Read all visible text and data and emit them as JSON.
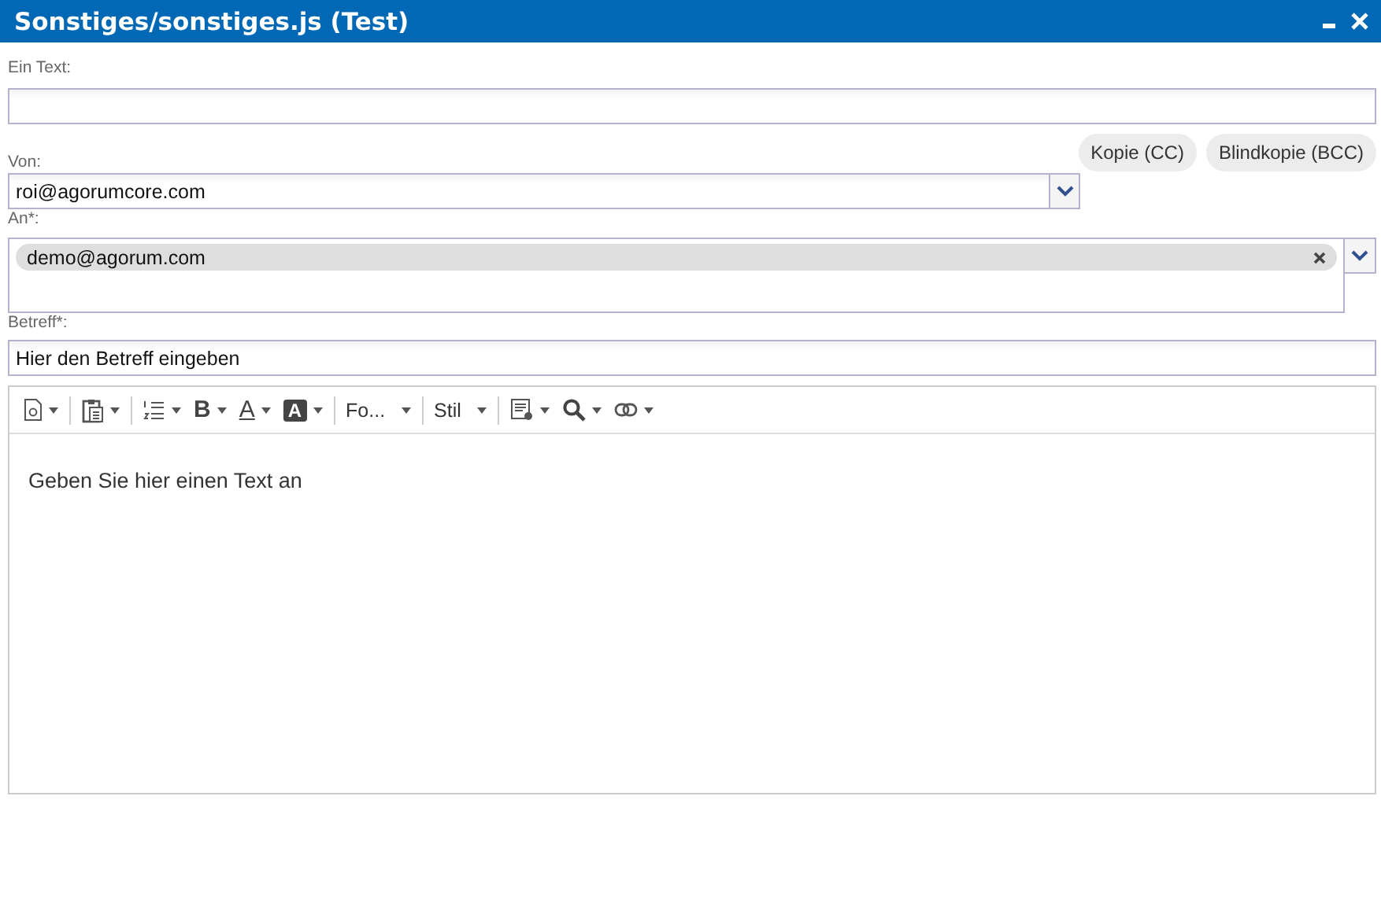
{
  "window": {
    "title": "Sonstiges/sonstiges.js (Test)"
  },
  "text_field": {
    "label": "Ein Text:"
  },
  "cc_buttons": [
    "Kopie (CC)",
    "Blindkopie (BCC)"
  ],
  "from": {
    "label": "Von:",
    "value": "roi@agorumcore.com"
  },
  "to": {
    "label": "An*:",
    "recipients": [
      {
        "address": "demo@agorum.com"
      }
    ]
  },
  "subject": {
    "label": "Betreff*:",
    "value": "Hier den Betreff eingeben"
  },
  "editor": {
    "toolbar": [
      {
        "kind": "doc"
      },
      {
        "kind": "separator"
      },
      {
        "kind": "paste"
      },
      {
        "kind": "separator"
      },
      {
        "kind": "list"
      },
      {
        "kind": "bold",
        "label": "B"
      },
      {
        "kind": "fontcolor",
        "label": "A"
      },
      {
        "kind": "bgcolor",
        "label": "A"
      },
      {
        "kind": "separator"
      },
      {
        "kind": "combo",
        "label": "Fo..."
      },
      {
        "kind": "separator"
      },
      {
        "kind": "combo",
        "label": "Stil"
      },
      {
        "kind": "separator"
      },
      {
        "kind": "template"
      },
      {
        "kind": "search"
      },
      {
        "kind": "link"
      }
    ],
    "text": "Geben Sie hier einen Text an"
  }
}
